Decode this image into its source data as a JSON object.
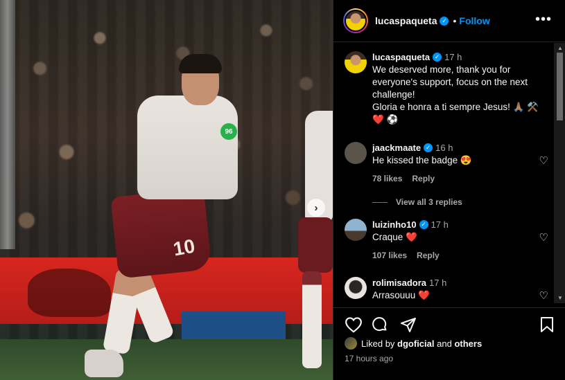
{
  "post": {
    "author": "lucaspaqueta",
    "follow_label": "Follow",
    "more_label": "•••",
    "carousel_next": "›",
    "shorts_number": "10",
    "badge_text": "96"
  },
  "caption": {
    "username": "lucaspaqueta",
    "time": "17 h",
    "lines": [
      "We deserved more, thank you for",
      "everyone's support, focus on the next",
      "challenge!",
      "Gloria e honra a ti sempre Jesus! 🙏🏽 ⚒️",
      "❤️ ⚽"
    ]
  },
  "comments": [
    {
      "username": "jaackmaate",
      "time": "16 h",
      "text": "He kissed the badge 😍",
      "likes": "78 likes",
      "reply": "Reply",
      "avatar_color": "#5a5548"
    },
    {
      "username": "luizinho10",
      "time": "17 h",
      "text": "Craque ❤️",
      "likes": "107 likes",
      "reply": "Reply",
      "avatar_color": "#6e8aa0"
    },
    {
      "username": "rolimisadora",
      "time": "17 h",
      "text": "Arrasouuu ❤️",
      "likes": "",
      "reply": "",
      "avatar_color": "#d9d4cf"
    }
  ],
  "view_replies": "View all 3 replies",
  "likes_summary": {
    "prefix": "Liked by",
    "user": "dgoficial",
    "middle": "and",
    "suffix": "others"
  },
  "timestamp": "17 hours ago",
  "icons": {
    "like": "heart-icon",
    "comment": "comment-icon",
    "share": "share-icon",
    "save": "bookmark-icon"
  },
  "colors": {
    "accent": "#0095f6",
    "background": "#000000",
    "text": "#f5f5f5",
    "muted": "#a8a8a8"
  }
}
